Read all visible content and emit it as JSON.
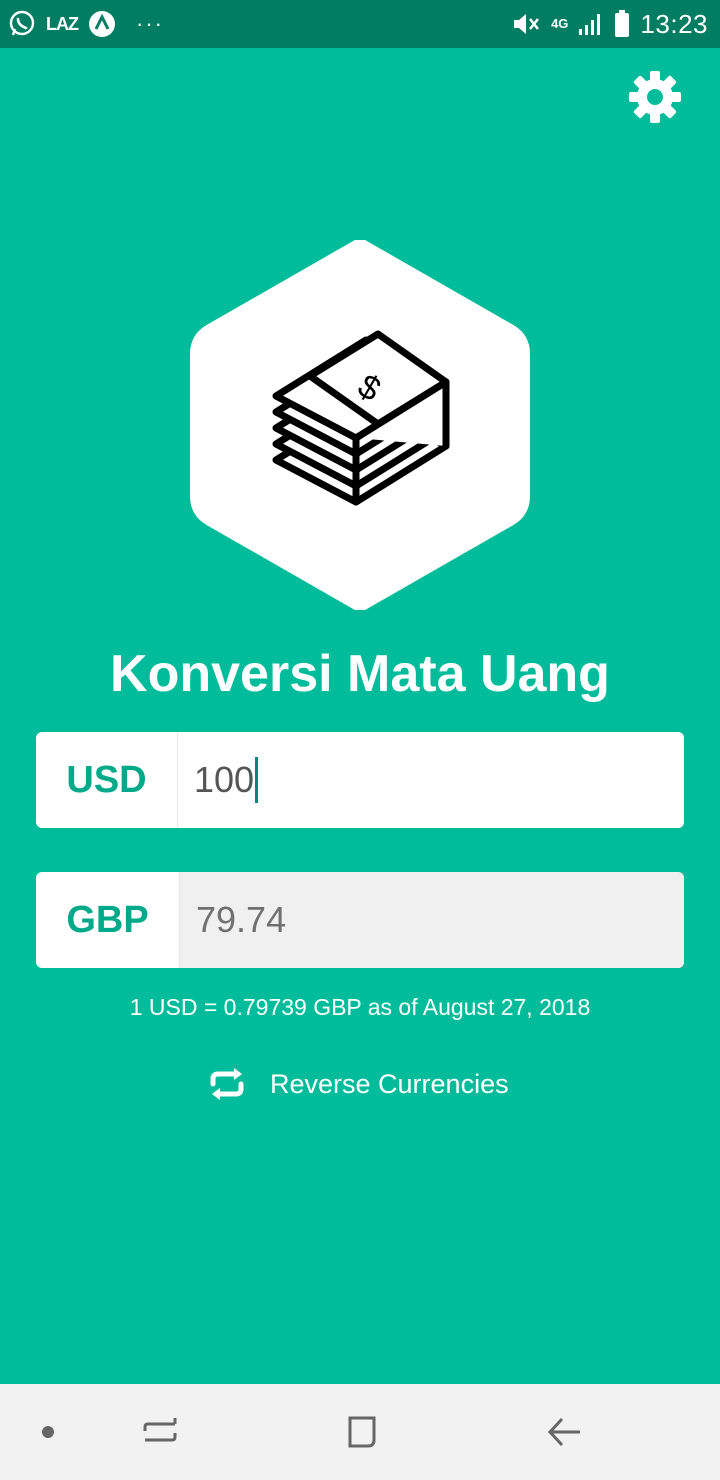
{
  "status_bar": {
    "left_icons": [
      "whatsapp-icon",
      "laz-icon",
      "autonavi-icon",
      "more-dots-icon"
    ],
    "laz_label": "LAZ",
    "dots": "···",
    "network_label": "4G",
    "time": "13:23"
  },
  "app": {
    "title": "Konversi Mata Uang",
    "settings_icon": "gear-icon"
  },
  "from": {
    "currency": "USD",
    "amount": "100"
  },
  "to": {
    "currency": "GBP",
    "amount": "79.74"
  },
  "rate_text": "1 USD = 0.79739 GBP as of August 27, 2018",
  "reverse_label": "Reverse Currencies",
  "colors": {
    "background": "#00bc9b",
    "status_bar": "#007d62",
    "accent": "#00a98a"
  }
}
